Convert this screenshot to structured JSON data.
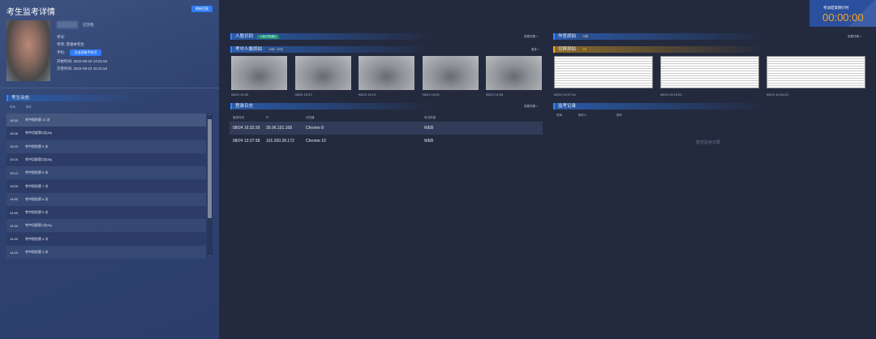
{
  "left": {
    "title": "考生监考详情",
    "refresh_button": "刷新页面",
    "name_status": "已交卷",
    "fields": {
      "exam_no": "考号:",
      "room": "考场: 普通本科生",
      "phone_label": "手机:",
      "phone_button": "点击获取手机号",
      "start": "开始时间: 2022-08-24 14:01:54",
      "submit": "交卷时间: 2022-08-24 15:41:54"
    },
    "activity": {
      "title": "考生动态",
      "col_time": "时间",
      "col_event": "事件",
      "rows": [
        {
          "t": "15:33",
          "e": "考中抓拍第 10 次"
        },
        {
          "t": "15:26",
          "e": "考中切屏第3次(3s)"
        },
        {
          "t": "15:23",
          "e": "考中抓拍第 9 次"
        },
        {
          "t": "15:15",
          "e": "考中切屏第2次(5s)"
        },
        {
          "t": "15:13",
          "e": "考中抓拍第 8 次"
        },
        {
          "t": "15:03",
          "e": "考中抓拍第 7 次"
        },
        {
          "t": "14:53",
          "e": "考中抓拍第 6 次"
        },
        {
          "t": "14:43",
          "e": "考中抓拍第 5 次"
        },
        {
          "t": "14:34",
          "e": "考中切屏第1次(9s)"
        },
        {
          "t": "14:33",
          "e": "考中抓拍第 4 次"
        },
        {
          "t": "14:23",
          "e": "考中抓拍第 3 次"
        }
      ]
    }
  },
  "face": {
    "title": "人脸识别",
    "badge": "人脸识别通过",
    "link": "查看详情 >"
  },
  "capture": {
    "title": "考中人像抓拍",
    "badge": "10次 / 10次",
    "link": "更多 >",
    "items": [
      "08/24 15:33",
      "08/24 15:23",
      "08/24 15:14",
      "08/24 15:04",
      "08/24 14:54"
    ]
  },
  "login": {
    "title": "登录日志",
    "link": "查看详情 >",
    "cols": [
      "登录时间",
      "IP",
      "浏览器",
      "考试终端"
    ],
    "rows": [
      [
        "08/24 16:32:39",
        "39.96.151.168",
        "Chrome 8",
        "WEB"
      ],
      [
        "08/24 13:37:38",
        "101.200.28.172",
        "Chrome 10",
        "WEB"
      ]
    ]
  },
  "timer": {
    "label": "考试结束倒计时",
    "value": "00:00:00"
  },
  "answer": {
    "title": "作答抓拍",
    "badge": "10张",
    "link": "查看详情 >"
  },
  "switch": {
    "title": "切屏抓拍",
    "badge": "3次",
    "items": [
      "08/24 15:27:04",
      "08/24 15:15:52",
      "08/24 14:34:43"
    ]
  },
  "proctor": {
    "title": "监考记录",
    "cols": [
      "时间",
      "操作人",
      "操作"
    ],
    "empty": "暂无监考记录"
  },
  "colors": {
    "accent": "#2f7cf6",
    "timer": "#f5a623"
  }
}
